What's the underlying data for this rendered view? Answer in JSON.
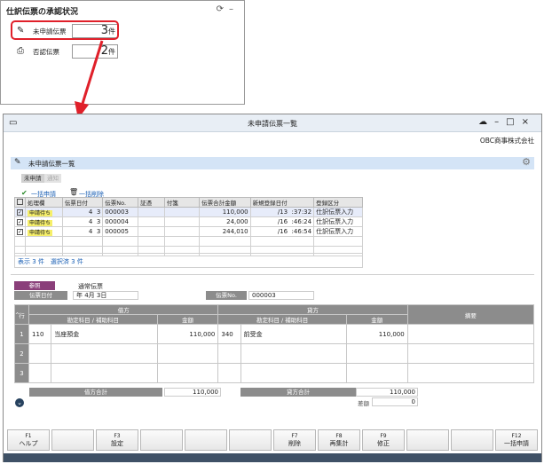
{
  "widget": {
    "title": "仕訳伝票の承認状況",
    "rows": [
      {
        "label": "未申請伝票",
        "count": "3",
        "unit": "件"
      },
      {
        "label": "否認伝票",
        "count": "2",
        "unit": "件"
      }
    ]
  },
  "window": {
    "title": "未申請伝票一覧",
    "company": "OBC商事株式会社",
    "header": "未申請伝票一覧",
    "tabs": [
      "未申請",
      "通知"
    ],
    "actions": {
      "bulk_apply": "一括申請",
      "bulk_delete": "一括削除"
    }
  },
  "grid": {
    "columns": [
      "",
      "処理欄",
      "伝票日付",
      "伝票No.",
      "証憑",
      "付箋",
      "伝票合計金額",
      "新規登録日付",
      "登録区分"
    ],
    "rows": [
      {
        "status": "申請待ち",
        "month": "4",
        "day": "3",
        "no": "000003",
        "amount": "110,000",
        "date": "/13",
        "time": ":37:32",
        "kind": "仕訳伝票入力"
      },
      {
        "status": "申請待ち",
        "month": "4",
        "day": "3",
        "no": "000004",
        "amount": "24,000",
        "date": "/16",
        "time": ":46:24",
        "kind": "仕訳伝票入力"
      },
      {
        "status": "申請待ち",
        "month": "4",
        "day": "3",
        "no": "000005",
        "amount": "244,010",
        "date": "/16",
        "time": ":46:54",
        "kind": "仕訳伝票入力"
      }
    ],
    "footer": "表示 3 件　選択済 3 件"
  },
  "detail": {
    "ref_label": "参照",
    "slip_type": "通常伝票",
    "date_label": "伝票日付",
    "date_value": "年 4月 3日",
    "no_label": "伝票No.",
    "no_value": "000003",
    "row_label": "行",
    "debit": "借方",
    "credit": "貸方",
    "account": "勘定科目 / 補助科目",
    "amount": "金額",
    "memo": "摘要",
    "lines": [
      {
        "no": "1",
        "dcode": "110",
        "dname": "当座預金",
        "damt": "110,000",
        "ccode": "340",
        "cname": "前受金",
        "camt": "110,000"
      },
      {
        "no": "2"
      },
      {
        "no": "3"
      }
    ],
    "debit_total_label": "借方合計",
    "debit_total": "110,000",
    "credit_total_label": "貸方合計",
    "credit_total": "110,000",
    "diff_label": "差額",
    "diff": "0"
  },
  "fkeys": [
    {
      "key": "F1",
      "label": "ヘルプ"
    },
    {
      "key": "",
      "label": ""
    },
    {
      "key": "F3",
      "label": "設定"
    },
    {
      "key": "",
      "label": ""
    },
    {
      "key": "",
      "label": ""
    },
    {
      "key": "",
      "label": ""
    },
    {
      "key": "F7",
      "label": "削除"
    },
    {
      "key": "F8",
      "label": "再集計"
    },
    {
      "key": "F9",
      "label": "修正"
    },
    {
      "key": "",
      "label": ""
    },
    {
      "key": "",
      "label": ""
    },
    {
      "key": "F12",
      "label": "一括申請"
    }
  ],
  "colors": {
    "highlight": "#e0202a",
    "arrow": "#e0202a",
    "header_band": "#d4e4f6",
    "status_bar": "#3f5166",
    "pending": "#f6ef6a"
  }
}
